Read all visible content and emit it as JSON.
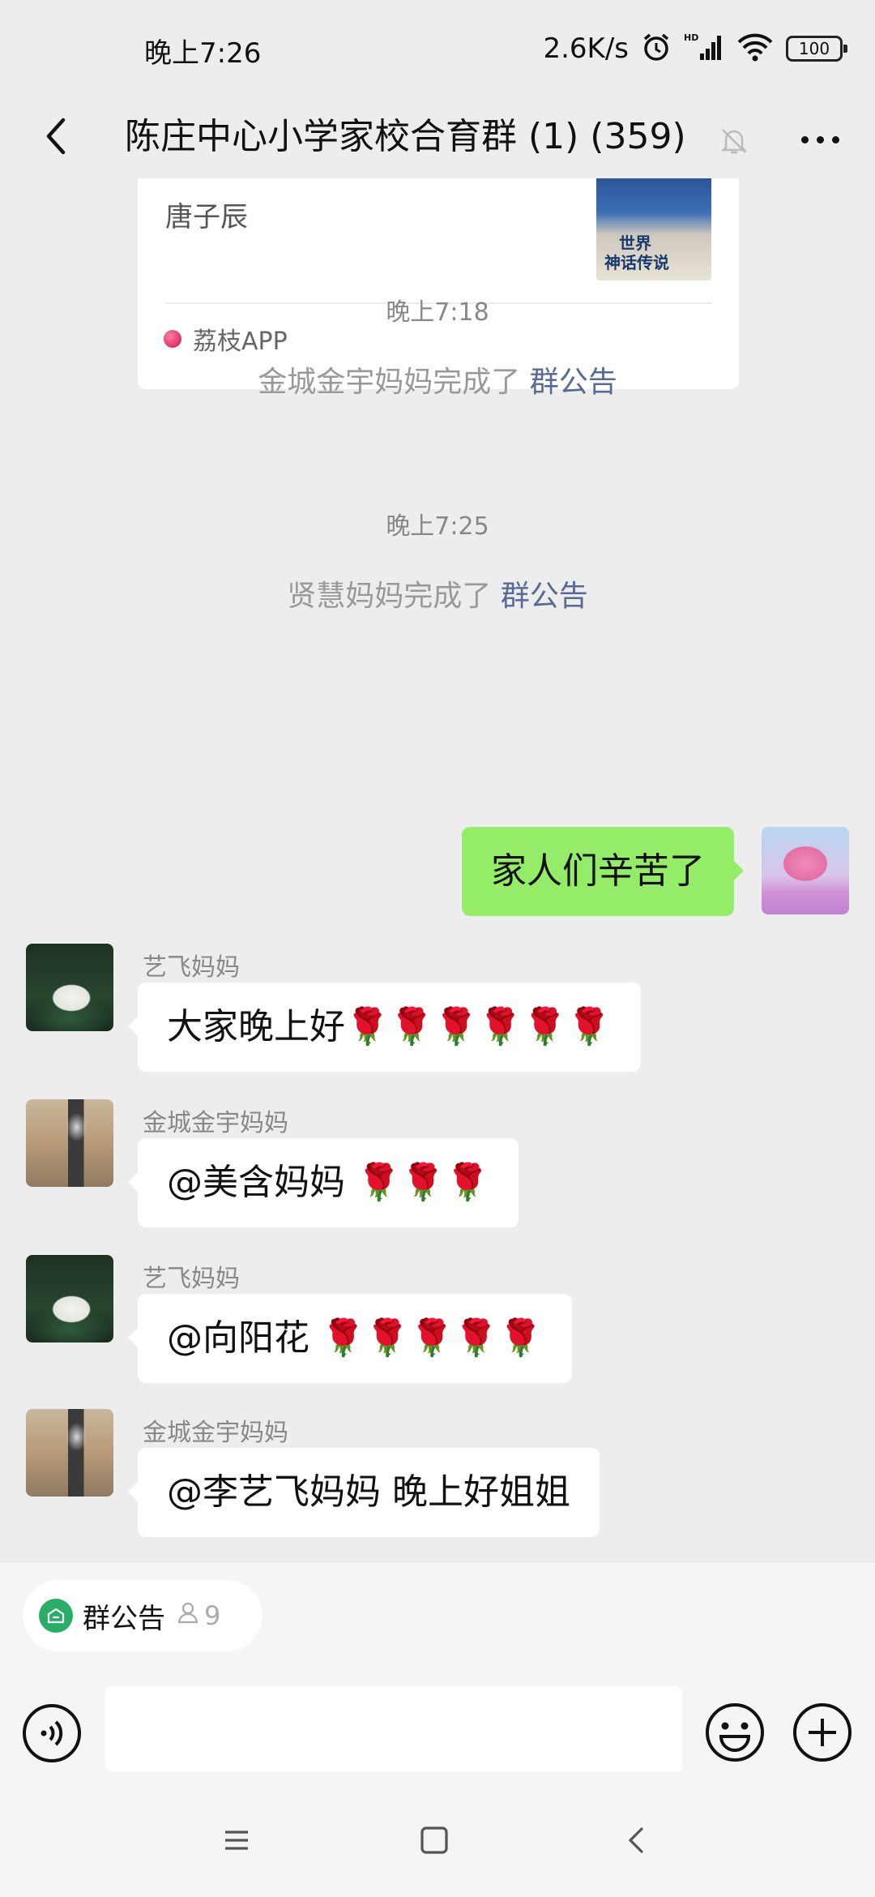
{
  "status_bar": {
    "time": "晚上7:26",
    "net_speed": "2.6K/s",
    "battery": "100",
    "icons": [
      "alarm-icon",
      "hd-signal-icon",
      "wifi-icon",
      "battery-icon"
    ]
  },
  "nav": {
    "title": "陈庄中心小学家校合育群 (1) (359)",
    "icons": [
      "back-icon",
      "mute-bell-icon",
      "more-icon"
    ]
  },
  "share_card": {
    "title": "唐子辰",
    "thumb_text_1": "世界",
    "thumb_text_2": "神话传说",
    "source": "荔枝APP"
  },
  "timeline": {
    "time_1": "晚上7:18",
    "sys_1_prefix": "金城金宇妈妈完成了 ",
    "sys_1_link": "群公告",
    "time_2": "晚上7:25",
    "sys_2_prefix": "贤慧妈妈完成了 ",
    "sys_2_link": "群公告"
  },
  "messages": [
    {
      "sender": "",
      "text": "家人们辛苦了",
      "mine": true
    },
    {
      "sender": "艺飞妈妈",
      "text": "大家晚上好🌹🌹🌹🌹🌹🌹",
      "mine": false
    },
    {
      "sender": "金城金宇妈妈",
      "text": "@美含妈妈 🌹🌹🌹",
      "mine": false
    },
    {
      "sender": "艺飞妈妈",
      "text": "@向阳花 🌹🌹🌹🌹🌹",
      "mine": false
    },
    {
      "sender": "金城金宇妈妈",
      "text": "@李艺飞妈妈  晚上好姐姐",
      "mine": false
    }
  ],
  "notice_chip": {
    "label": "群公告",
    "count": "9"
  },
  "input": {
    "value": "",
    "placeholder": ""
  },
  "colors": {
    "background": "#ededed",
    "my_bubble": "#95ec69",
    "link": "#576b95",
    "notice_green": "#2aae67"
  }
}
